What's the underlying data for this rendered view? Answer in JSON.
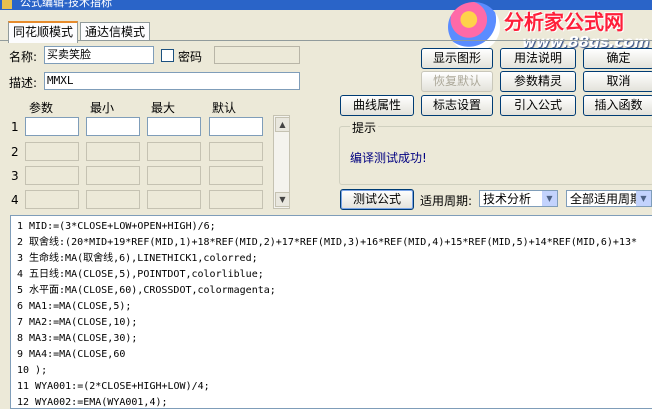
{
  "window": {
    "title": "公式编辑-技术指标"
  },
  "watermark": {
    "brand": "分析家公式网",
    "url": "www.88gs.com"
  },
  "tabs": [
    {
      "label": "同花顺模式"
    },
    {
      "label": "通达信模式"
    }
  ],
  "form": {
    "name_label": "名称:",
    "name_value": "买卖笑脸",
    "password_label": "密码",
    "desc_label": "描述:",
    "desc_value": "MMXL"
  },
  "params": {
    "headers": [
      "参数",
      "最小",
      "最大",
      "默认"
    ],
    "rows": [
      "1",
      "2",
      "3",
      "4"
    ]
  },
  "buttons": {
    "show_chart": "显示图形",
    "usage": "用法说明",
    "ok": "确定",
    "restore_default": "恢复默认",
    "param_wizard": "参数精灵",
    "cancel": "取消",
    "curve_props": "曲线属性",
    "marker_settings": "标志设置",
    "import_formula": "引入公式",
    "insert_function": "插入函数",
    "test_formula": "测试公式"
  },
  "hint": {
    "title": "提示",
    "message": "编译测试成功!"
  },
  "period": {
    "label": "适用周期:",
    "type_value": "技术分析",
    "period_value": "全部适用周期"
  },
  "code_lines": [
    "1 MID:=(3*CLOSE+LOW+OPEN+HIGH)/6;",
    "2 取舍线:(20*MID+19*REF(MID,1)+18*REF(MID,2)+17*REF(MID,3)+16*REF(MID,4)+15*REF(MID,5)+14*REF(MID,6)+13*",
    "3 生命线:MA(取舍线,6),LINETHICK1,colorred;",
    "4 五日线:MA(CLOSE,5),POINTDOT,colorliblue;",
    "5 水平面:MA(CLOSE,60),CROSSDOT,colormagenta;",
    "6 MA1:=MA(CLOSE,5);",
    "7 MA2:=MA(CLOSE,10);",
    "8 MA3:=MA(CLOSE,30);",
    "9 MA4:=MA(CLOSE,60",
    "10 );",
    "11 WYA001:=(2*CLOSE+HIGH+LOW)/4;",
    "12 WYA002:=EMA(WYA001,4);"
  ]
}
